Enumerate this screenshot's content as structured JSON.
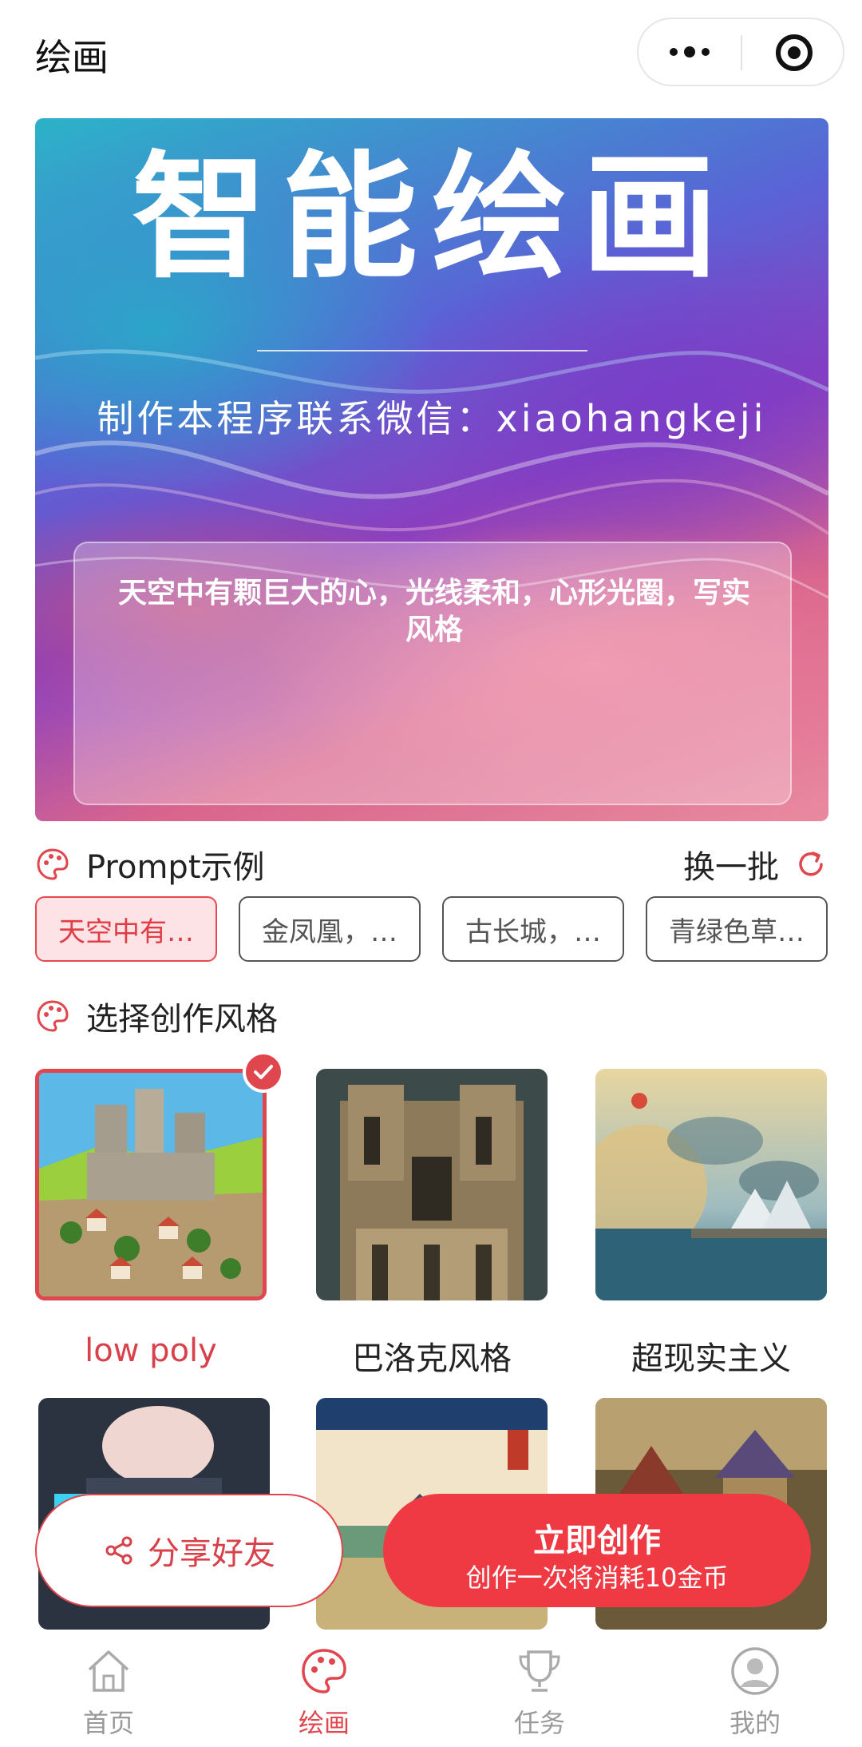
{
  "header": {
    "title": "绘画",
    "more_icon": "more-dots-icon",
    "close_icon": "record-close-icon"
  },
  "banner": {
    "title": "智能绘画",
    "subtitle": "制作本程序联系微信：xiaohangkeji",
    "prompt_text": "天空中有颗巨大的心，光线柔和，心形光圈，写实风格"
  },
  "prompt_section": {
    "title": "Prompt示例",
    "refresh_label": "换一批",
    "chips": [
      {
        "label": "天空中有…",
        "active": true
      },
      {
        "label": "金凤凰，…",
        "active": false
      },
      {
        "label": "古长城，…",
        "active": false
      },
      {
        "label": "青绿色草…",
        "active": false
      }
    ]
  },
  "style_section": {
    "title": "选择创作风格",
    "styles": [
      {
        "label": "low poly",
        "selected": true
      },
      {
        "label": "巴洛克风格",
        "selected": false
      },
      {
        "label": "超现实主义",
        "selected": false
      },
      {
        "label": "",
        "selected": false
      },
      {
        "label": "",
        "selected": false
      },
      {
        "label": "",
        "selected": false
      }
    ]
  },
  "actions": {
    "share_label": "分享好友",
    "create_label": "立即创作",
    "create_sub": "创作一次将消耗10金币"
  },
  "tabbar": {
    "items": [
      {
        "label": "首页",
        "icon": "home-icon"
      },
      {
        "label": "绘画",
        "icon": "palette-icon"
      },
      {
        "label": "任务",
        "icon": "trophy-icon"
      },
      {
        "label": "我的",
        "icon": "user-icon"
      }
    ]
  },
  "colors": {
    "accent": "#e0464e",
    "create_button": "#ef3a43",
    "chip_active_bg": "#fde3e5"
  }
}
